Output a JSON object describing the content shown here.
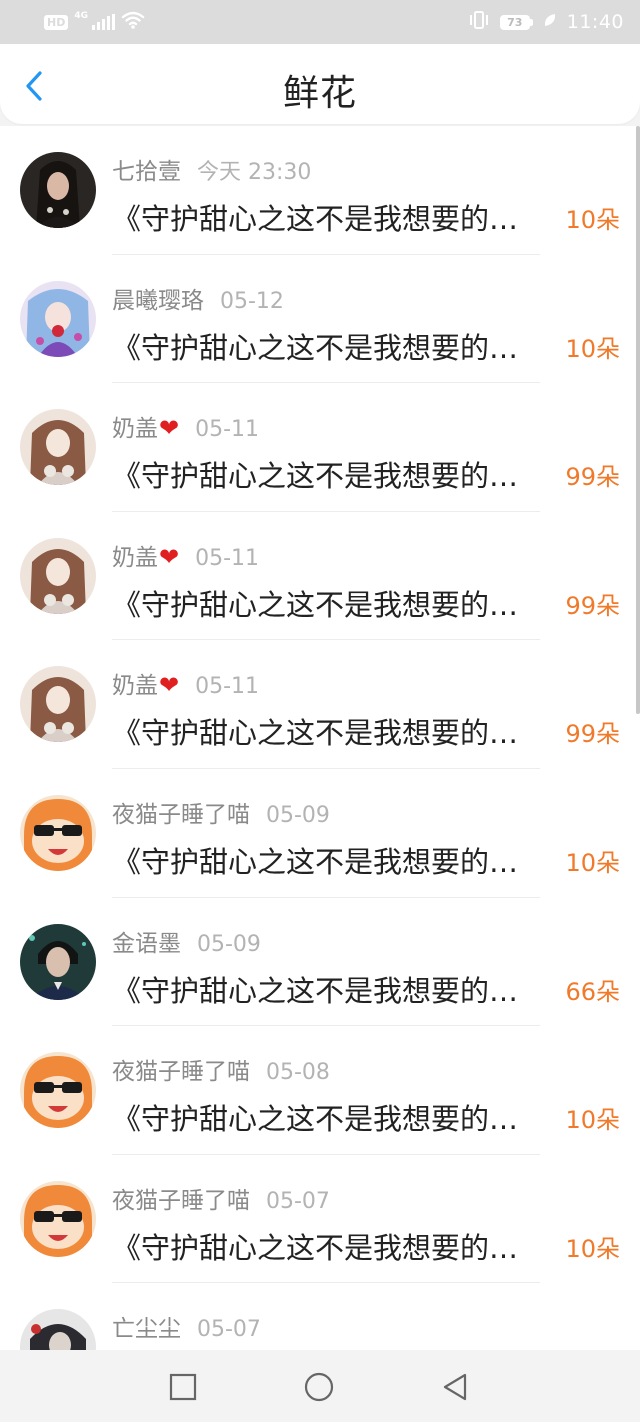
{
  "status_bar": {
    "hd": "HD",
    "network": "4G",
    "battery": "73",
    "time": "11:40"
  },
  "header": {
    "title": "鲜花",
    "back_icon": "chevron-left-icon"
  },
  "colors": {
    "accent": "#2196f3",
    "flower_count": "#f07a2a",
    "heart": "#e02020"
  },
  "records": [
    {
      "name": "七拾壹",
      "time": "今天 23:30",
      "book": "《守护甜心之这不是我想要的…",
      "count": "10朵",
      "avatar": "avatar-dark-hair"
    },
    {
      "name": "晨曦璎珞",
      "time": "05-12",
      "book": "《守护甜心之这不是我想要的…",
      "count": "10朵",
      "avatar": "avatar-anime-blue"
    },
    {
      "name": "奶盖",
      "heart": "❤",
      "time": "05-11",
      "book": "《守护甜心之这不是我想要的…",
      "count": "99朵",
      "avatar": "avatar-anime-brown"
    },
    {
      "name": "奶盖",
      "heart": "❤",
      "time": "05-11",
      "book": "《守护甜心之这不是我想要的…",
      "count": "99朵",
      "avatar": "avatar-anime-brown"
    },
    {
      "name": "奶盖",
      "heart": "❤",
      "time": "05-11",
      "book": "《守护甜心之这不是我想要的…",
      "count": "99朵",
      "avatar": "avatar-anime-brown"
    },
    {
      "name": "夜猫子睡了喵",
      "time": "05-09",
      "book": "《守护甜心之这不是我想要的…",
      "count": "10朵",
      "avatar": "avatar-umaru"
    },
    {
      "name": "金语墨",
      "time": "05-09",
      "book": "《守护甜心之这不是我想要的…",
      "count": "66朵",
      "avatar": "avatar-boy-dark"
    },
    {
      "name": "夜猫子睡了喵",
      "time": "05-08",
      "book": "《守护甜心之这不是我想要的…",
      "count": "10朵",
      "avatar": "avatar-umaru"
    },
    {
      "name": "夜猫子睡了喵",
      "time": "05-07",
      "book": "《守护甜心之这不是我想要的…",
      "count": "10朵",
      "avatar": "avatar-umaru"
    },
    {
      "name": "亡尘尘",
      "time": "05-07",
      "book": "",
      "count": "",
      "avatar": "avatar-dark-red"
    }
  ],
  "nav_bar": {
    "recents_icon": "square-icon",
    "home_icon": "circle-icon",
    "back_icon": "triangle-back-icon"
  }
}
